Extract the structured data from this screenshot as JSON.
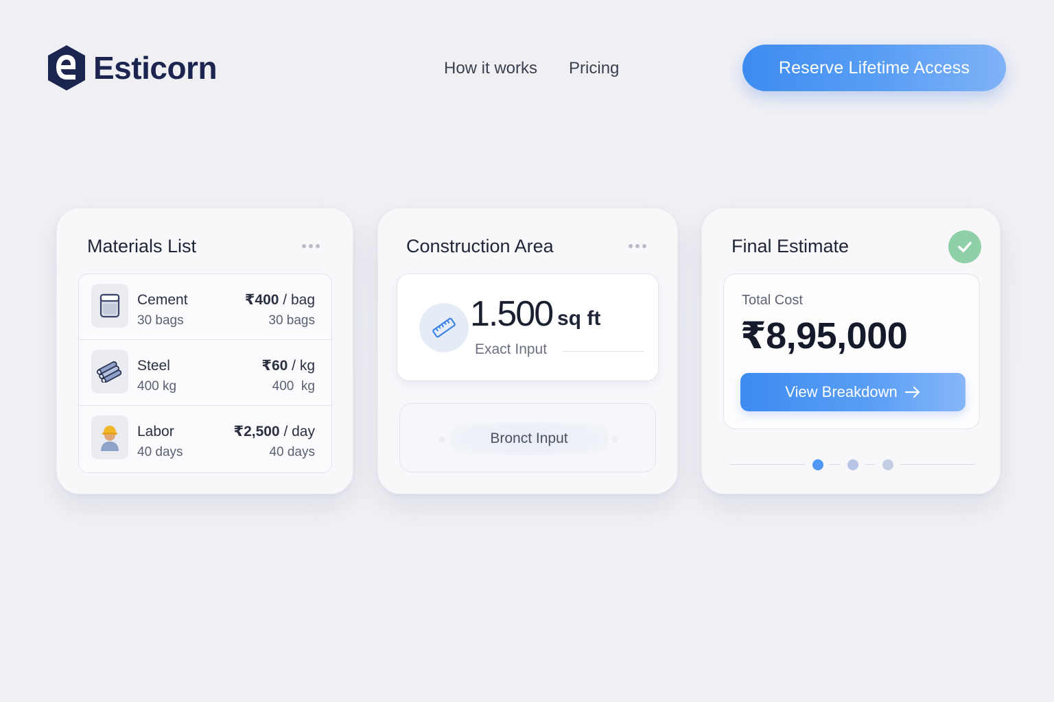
{
  "brand": {
    "name": "Esticorn",
    "logo_icon": "hexagon-e-logo-icon"
  },
  "nav": {
    "links": [
      "How it works",
      "Pricing"
    ]
  },
  "cta": {
    "label": "Reserve Lifetime Access"
  },
  "colors": {
    "accent": "#3d8cf0",
    "brand": "#1b2550",
    "success": "#8fd0a8"
  },
  "materials": {
    "title": "Materials List",
    "items": [
      {
        "name": "Cement",
        "qty": "30 bags",
        "price_symbol": "₹",
        "price_amount": "400",
        "price_unit": " / bag",
        "qty_right": "30 bags",
        "icon": "cement-bag-icon"
      },
      {
        "name": "Steel",
        "qty": "400 kg",
        "price_symbol": "₹",
        "price_amount": "60",
        "price_unit": " / kg",
        "qty_right": "400  kg",
        "icon": "steel-bars-icon"
      },
      {
        "name": "Labor",
        "qty": "40 days",
        "price_symbol": "₹",
        "price_amount": "2,500",
        "price_unit": " / day",
        "qty_right": "40 days",
        "icon": "worker-icon"
      }
    ]
  },
  "area": {
    "title": "Construction Area",
    "value": "1.500",
    "unit": "sq ft",
    "caption": "Exact Input",
    "secondary_input": "Bronct Input"
  },
  "estimate": {
    "title": "Final Estimate",
    "label": "Total Cost",
    "value": "₹8,95,000",
    "button_label": "View Breakdown",
    "pager": {
      "pages": 3,
      "active": 1
    }
  }
}
